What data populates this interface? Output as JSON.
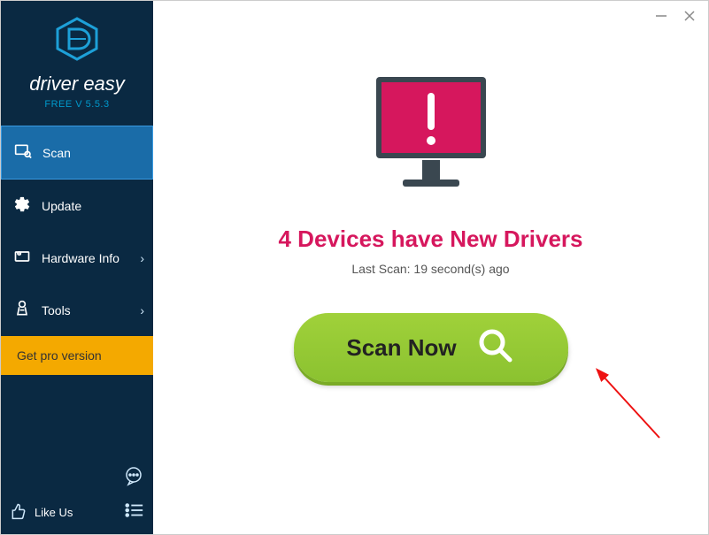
{
  "brand": {
    "name": "driver easy",
    "version_label": "FREE V 5.5.3"
  },
  "sidebar": {
    "items": [
      {
        "label": "Scan"
      },
      {
        "label": "Update"
      },
      {
        "label": "Hardware Info"
      },
      {
        "label": "Tools"
      }
    ],
    "pro_label": "Get pro version",
    "likeus_label": "Like Us"
  },
  "main": {
    "headline": "4 Devices have New Drivers",
    "last_scan": "Last Scan: 19 second(s) ago",
    "scan_button": "Scan Now"
  },
  "colors": {
    "sidebar_bg": "#0a2942",
    "active_bg": "#1a6ca8",
    "pro_bg": "#f4a900",
    "accent": "#d6175d",
    "scan_btn": "#8bc230"
  }
}
